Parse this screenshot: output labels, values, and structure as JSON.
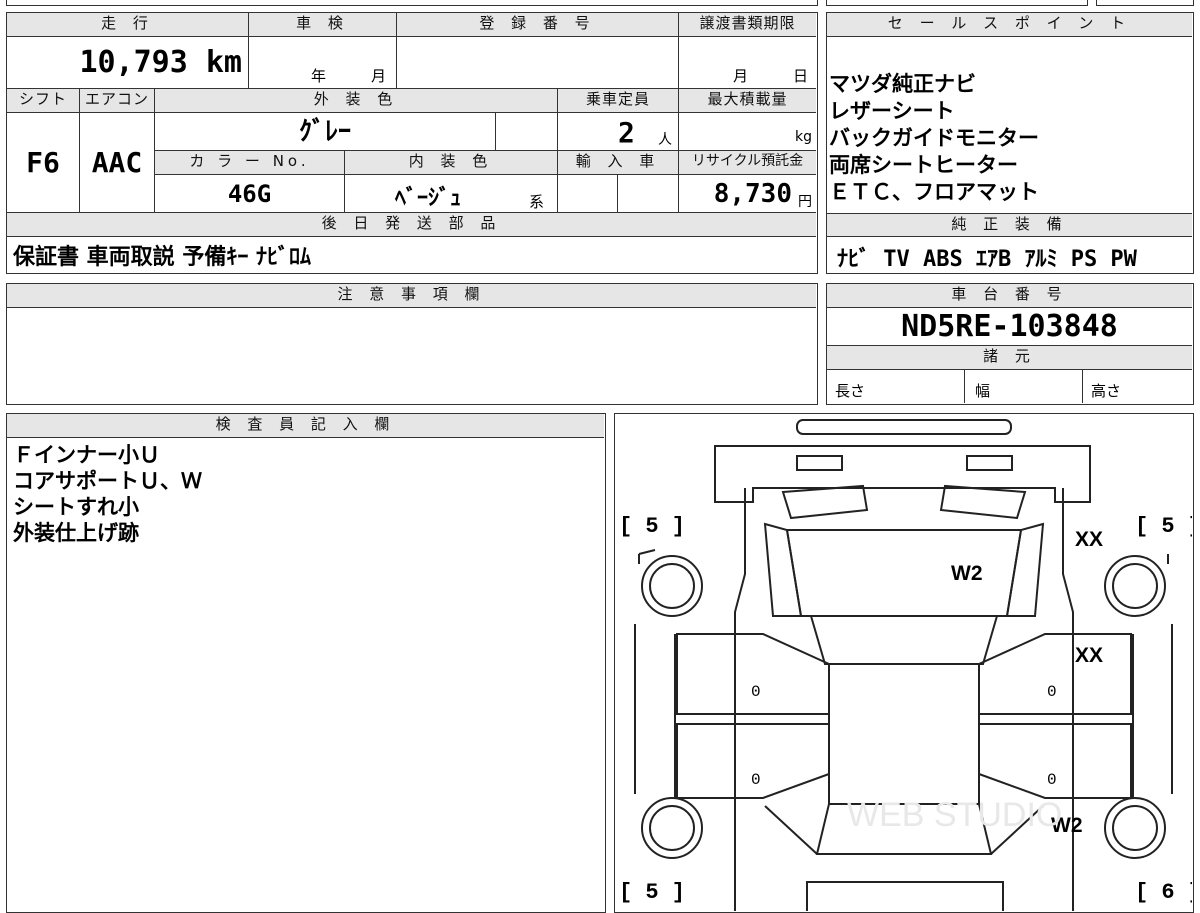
{
  "row1": {
    "mileage_header": "走 行",
    "mileage_value": "10,793 km",
    "inspection_header": "車 検",
    "inspection_year": "年",
    "inspection_month": "月",
    "registration_header": "登 録 番 号",
    "transfer_header": "譲渡書類期限",
    "transfer_month": "月",
    "transfer_day": "日"
  },
  "row2": {
    "shift_header": "シフト",
    "aircon_header": "エアコン",
    "exterior_header": "外 装 色",
    "capacity_header": "乗車定員",
    "load_header": "最大積載量",
    "shift_value": "F6",
    "aircon_value": "AAC",
    "exterior_value": "ｸﾞﾚｰ",
    "capacity_value": "2",
    "capacity_unit": "人",
    "load_unit": "kg",
    "color_no_header": "カ ラ ー No.",
    "interior_header": "内 装 色",
    "import_header": "輸 入 車",
    "recycle_header": "リサイクル預託金",
    "color_no_value": "46G",
    "interior_value": "ﾍﾞｰｼﾞｭ",
    "interior_suffix": "系",
    "recycle_value": "8,730",
    "recycle_unit": "円"
  },
  "later_parts": {
    "header": "後 日 発 送 部 品",
    "value": "保証書 車両取説 予備ｷｰ ﾅﾋﾞﾛﾑ"
  },
  "sales_points": {
    "header": "セ ー ル ス ポ イ ン ト",
    "items": [
      "マツダ純正ナビ",
      "レザーシート",
      "バックガイドモニター",
      "両席シートヒーター",
      "ＥＴＣ、フロアマット"
    ]
  },
  "genuine_equipment": {
    "header": "純 正 装 備",
    "value": "ﾅﾋﾞ TV ABS ｴｱB ｱﾙﾐ PS PW"
  },
  "caution": {
    "header": "注 意 事 項 欄"
  },
  "chassis": {
    "header": "車 台 番 号",
    "value": "ND5RE-103848"
  },
  "specs": {
    "header": "諸 元",
    "length": "長さ",
    "width": "幅",
    "height": "高さ"
  },
  "inspector": {
    "header": "検 査 員 記 入 欄",
    "notes": [
      "Ｆインナー小Ｕ",
      "コアサポートＵ、Ｗ",
      "シートすれ小",
      "外装仕上げ跡"
    ]
  },
  "diagram": {
    "tire_front_left": "[ 5 ]",
    "tire_front_right": "[ 5 ]",
    "tire_rear_left": "[ 5 ]",
    "tire_rear_right": "[ 6 ]",
    "mark_fender_right": "XX",
    "mark_hood": "W2",
    "mark_door_front_right": "XX",
    "mark_quarter_right": "W2",
    "door_fl": "0",
    "door_rl": "0",
    "door_fr": "0",
    "door_rr": "0",
    "watermark": "WEB STUDIO"
  }
}
